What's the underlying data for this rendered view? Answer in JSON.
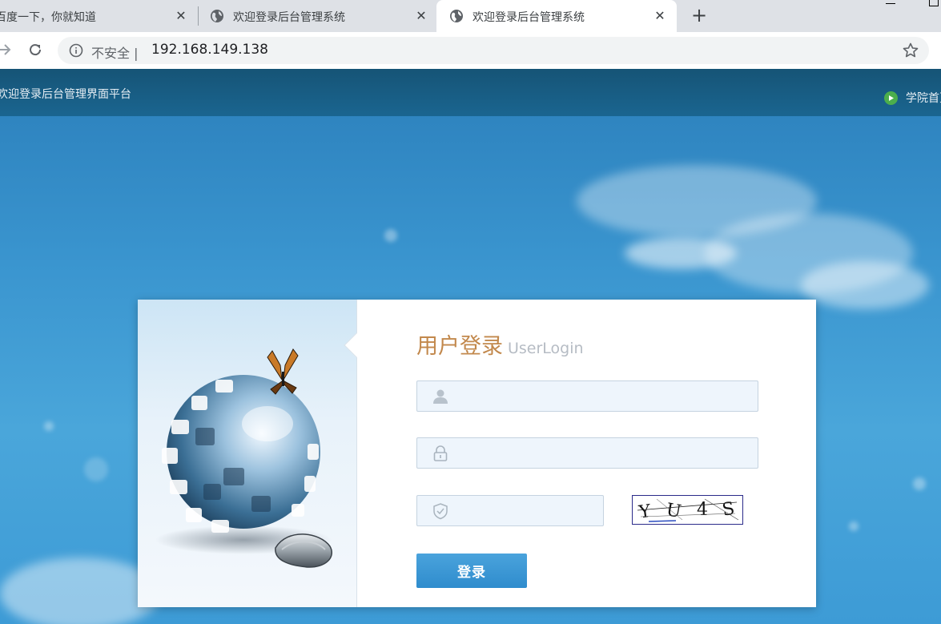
{
  "browser": {
    "tabs": [
      {
        "title": "百度一下，你就知道"
      },
      {
        "title": "欢迎登录后台管理系统"
      },
      {
        "title": "欢迎登录后台管理系统"
      }
    ],
    "close_glyph": "✕",
    "new_tab_glyph": "+",
    "address": {
      "insecure_label": "不安全 |",
      "url": "192.168.149.138"
    }
  },
  "header": {
    "site_title": "欢迎登录后台管理界面平台",
    "home_link": "学院首页"
  },
  "login": {
    "title_cn": "用户登录",
    "title_en": "UserLogin",
    "username_value": "",
    "password_value": "",
    "captcha_value": "",
    "captcha_text": "Y U 4 S",
    "submit_label": "登录"
  },
  "colors": {
    "title_accent": "#c2884c",
    "button": "#3a98d4",
    "header_bar": "#185d84",
    "background": "#3a95cf"
  }
}
